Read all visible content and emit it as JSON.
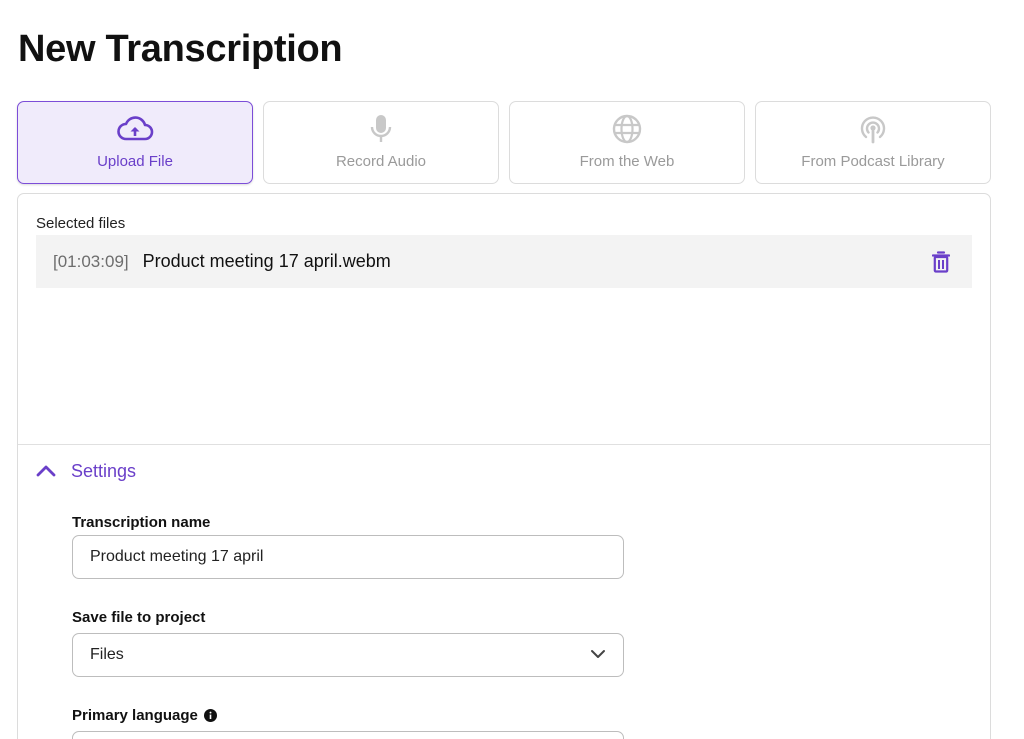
{
  "page": {
    "title": "New Transcription"
  },
  "source_tabs": [
    {
      "label": "Upload File",
      "icon": "cloud-upload-icon",
      "active": true
    },
    {
      "label": "Record Audio",
      "icon": "microphone-icon",
      "active": false
    },
    {
      "label": "From the Web",
      "icon": "globe-icon",
      "active": false
    },
    {
      "label": "From Podcast Library",
      "icon": "podcast-icon",
      "active": false
    }
  ],
  "selected_files": {
    "label": "Selected files",
    "files": [
      {
        "duration": "[01:03:09]",
        "name": "Product meeting 17 april.webm"
      }
    ]
  },
  "settings": {
    "label": "Settings",
    "expanded": true,
    "transcription_name": {
      "label": "Transcription name",
      "value": "Product meeting 17 april"
    },
    "project": {
      "label": "Save file to project",
      "value": "Files"
    },
    "language": {
      "label": "Primary language",
      "value": ""
    }
  },
  "colors": {
    "accent": "#6a3fc9",
    "accent_bg": "#f0ebfb",
    "icon_inactive": "#c8c8c8",
    "border": "#dcdcdc"
  }
}
